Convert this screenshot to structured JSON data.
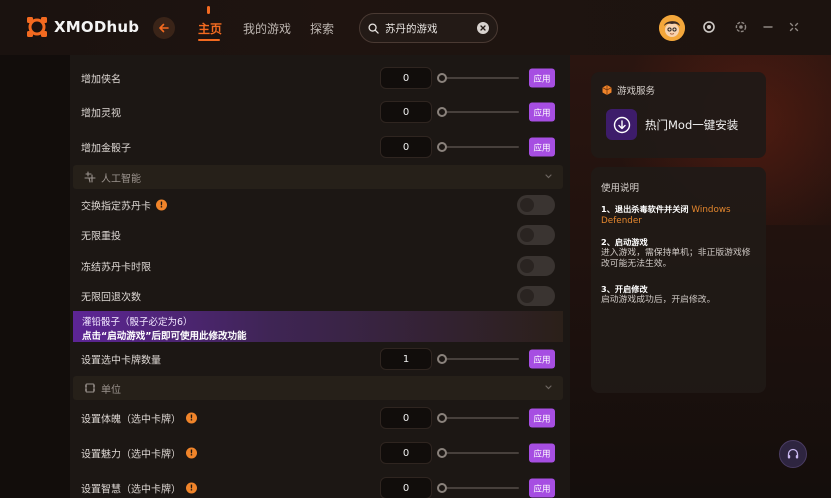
{
  "app": {
    "name": "XMODhub"
  },
  "nav": {
    "tabs": [
      {
        "label": "主页",
        "active": true
      },
      {
        "label": "我的游戏",
        "active": false
      },
      {
        "label": "探索",
        "active": false
      }
    ]
  },
  "search": {
    "value": "苏丹的游戏"
  },
  "main": {
    "rows_top": [
      {
        "label": "增加侠名",
        "value": "0",
        "button": "应用"
      },
      {
        "label": "增加灵视",
        "value": "0",
        "button": "应用"
      },
      {
        "label": "增加金骰子",
        "value": "0",
        "button": "应用"
      }
    ],
    "section_ai": {
      "label": "人工智能"
    },
    "toggles": [
      {
        "label": "交换指定苏丹卡",
        "warning": "!"
      },
      {
        "label": "无限重投"
      },
      {
        "label": "冻结苏丹卡时限"
      },
      {
        "label": "无限回退次数"
      }
    ],
    "banner": {
      "title": "灌铅骰子（骰子必定为6）",
      "subtitle": "点击“启动游戏”后即可使用此修改功能"
    },
    "row_card_count": {
      "label": "设置选中卡牌数量",
      "value": "1",
      "button": "应用"
    },
    "section_unit": {
      "label": "单位"
    },
    "rows_unit": [
      {
        "label": "设置体魄（选中卡牌）",
        "warning": "!",
        "value": "0",
        "button": "应用"
      },
      {
        "label": "设置魅力（选中卡牌）",
        "warning": "!",
        "value": "0",
        "button": "应用"
      },
      {
        "label": "设置智慧（选中卡牌）",
        "warning": "!",
        "value": "0",
        "button": "应用"
      }
    ]
  },
  "services": {
    "title": "游戏服务",
    "install_label": "热门Mod一键安装"
  },
  "instructions": {
    "title": "使用说明",
    "step1_head": "1、退出杀毒软件并关闭",
    "step1_link": "Windows Defender",
    "step2_head": "2、启动游戏",
    "step2_body": "进入游戏，需保持单机；非正版游戏修改可能无法生效。",
    "step3_head": "3、开启修改",
    "step3_body": "启动游戏成功后，开启修改。"
  },
  "colors": {
    "accent": "#f36a20",
    "apply_button": "#a64ee2",
    "banner": "#5d2596"
  },
  "icons": [
    "logo-icon",
    "back-arrow-icon",
    "search-icon",
    "clear-icon",
    "avatar",
    "user-status-icon",
    "settings-icon",
    "minimize-icon",
    "close-icon",
    "ai-icon",
    "chevron-down-icon",
    "unit-icon",
    "services-icon",
    "download-icon",
    "headset-icon"
  ]
}
